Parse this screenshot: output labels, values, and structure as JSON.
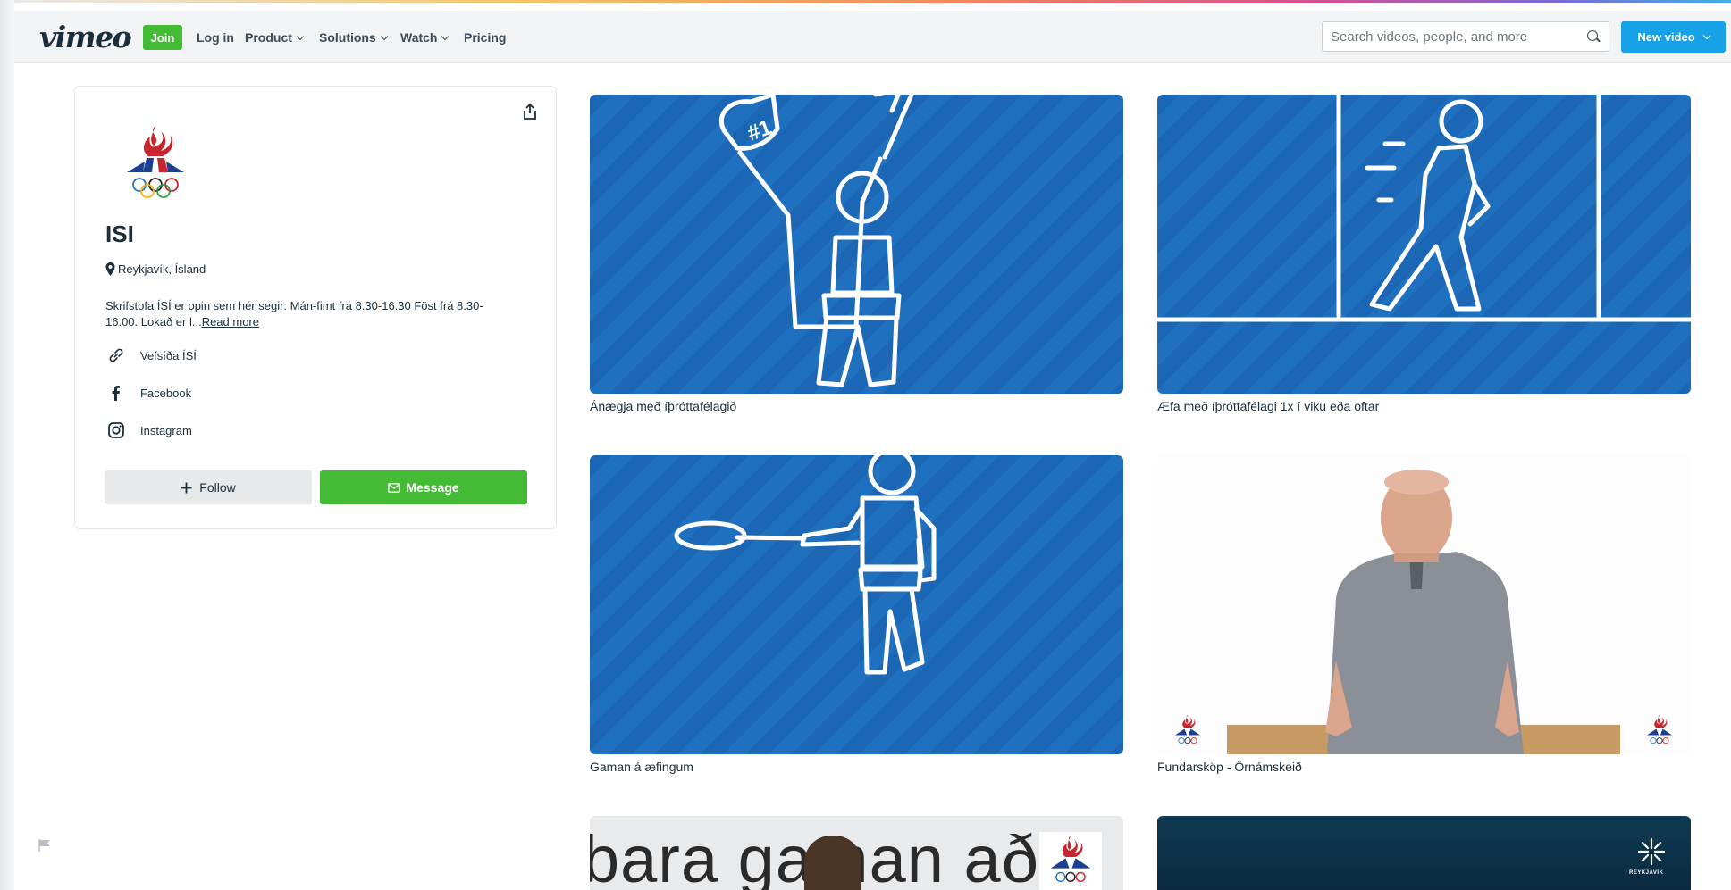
{
  "header": {
    "logo": "vimeo",
    "join_label": "Join",
    "login_label": "Log in",
    "nav": [
      {
        "label": "Product",
        "dropdown": true
      },
      {
        "label": "Solutions",
        "dropdown": true
      },
      {
        "label": "Watch",
        "dropdown": true
      },
      {
        "label": "Pricing",
        "dropdown": false
      }
    ],
    "search_placeholder": "Search videos, people, and more",
    "new_video_label": "New video"
  },
  "profile": {
    "name": "ISI",
    "location": "Reykjavík, Ísland",
    "bio": "Skrifstofa ÍSÍ er opin sem hér segir: Mán-fimt frá 8.30-16.30 Föst frá 8.30-16.00. Lokað er l...",
    "read_more": "Read more",
    "links": [
      {
        "label": "Vefsíða ÍSÍ",
        "icon": "link-icon"
      },
      {
        "label": "Facebook",
        "icon": "facebook-icon"
      },
      {
        "label": "Instagram",
        "icon": "instagram-icon"
      }
    ],
    "follow_label": "Follow",
    "message_label": "Message"
  },
  "videos": [
    {
      "title": "Ánægja með íþróttafélagið"
    },
    {
      "title": "Æfa með íþróttafélagi 1x í viku eða oftar"
    },
    {
      "title": "Gaman á æfingum"
    },
    {
      "title": "Fundarsköp - Örnámskeið"
    },
    {
      "title": "",
      "thumb_text": "bara gaman að s"
    },
    {
      "title": "",
      "thumb_text": "REYKJAVIK"
    }
  ],
  "thumb_labels": {
    "fan_glove": "#1"
  },
  "colors": {
    "accent_green": "#44bb34",
    "accent_blue": "#17a1e6",
    "thumb_blue": "#1b67b5"
  }
}
